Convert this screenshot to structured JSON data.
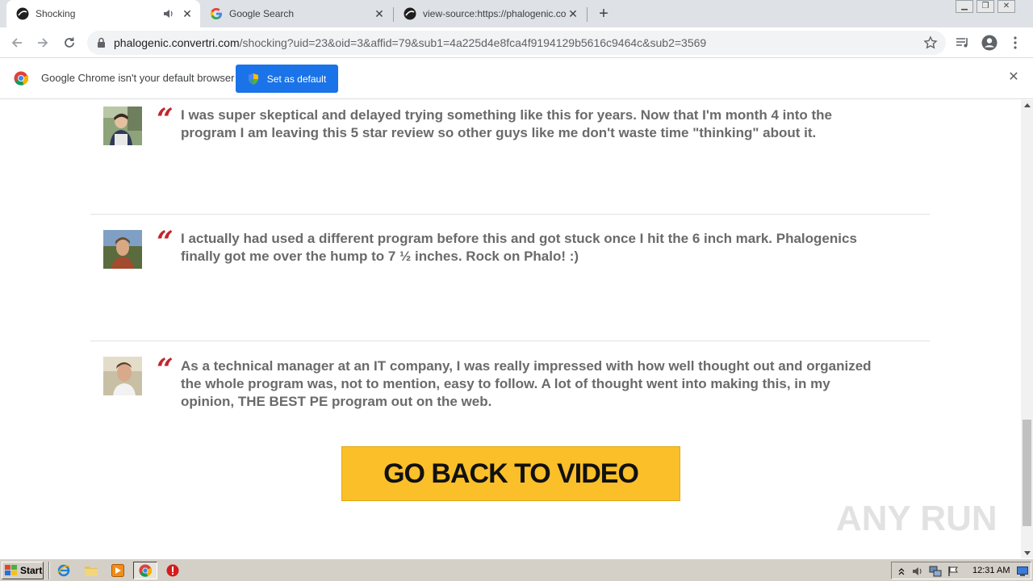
{
  "browser": {
    "tabs": [
      {
        "title": "Shocking",
        "active": true,
        "audio": true
      },
      {
        "title": "Google Search",
        "active": false
      },
      {
        "title": "view-source:https://phalogenic.conv",
        "active": false
      }
    ],
    "address": {
      "domain": "phalogenic.convertri.com",
      "path": "/shocking?uid=23&oid=3&affid=79&sub1=4a225d4e8fca4f9194129b5616c9464c&sub2=3569"
    }
  },
  "infobar": {
    "message": "Google Chrome isn't your default browser",
    "button_label": "Set as default"
  },
  "page": {
    "quote_mark": "“",
    "reviews": [
      {
        "text": "I was super skeptical and delayed trying something like this for years. Now that I'm month 4 into the program I am leaving this 5 star review so other guys like me don't waste time \"thinking\" about it."
      },
      {
        "text": "I actually had used a different program before this and got stuck once I hit the 6 inch mark. Phalogenics finally got me over the hump to 7 ½ inches. Rock on Phalo! :)"
      },
      {
        "text": "As a technical manager at an IT company, I was really impressed with how well thought out and organized the whole program was, not to mention, easy to follow. A lot of thought went into making this, in my opinion, THE BEST PE program out on the web."
      }
    ],
    "cta_label": "GO BACK TO VIDEO",
    "watermark_text": "ANY RUN"
  },
  "taskbar": {
    "start_label": "Start",
    "clock": "12:31 AM"
  },
  "colors": {
    "cta": "#fbbf2a",
    "quote": "#c0272d",
    "review_text": "#6a6a6a",
    "chrome_button": "#1a73e8"
  }
}
